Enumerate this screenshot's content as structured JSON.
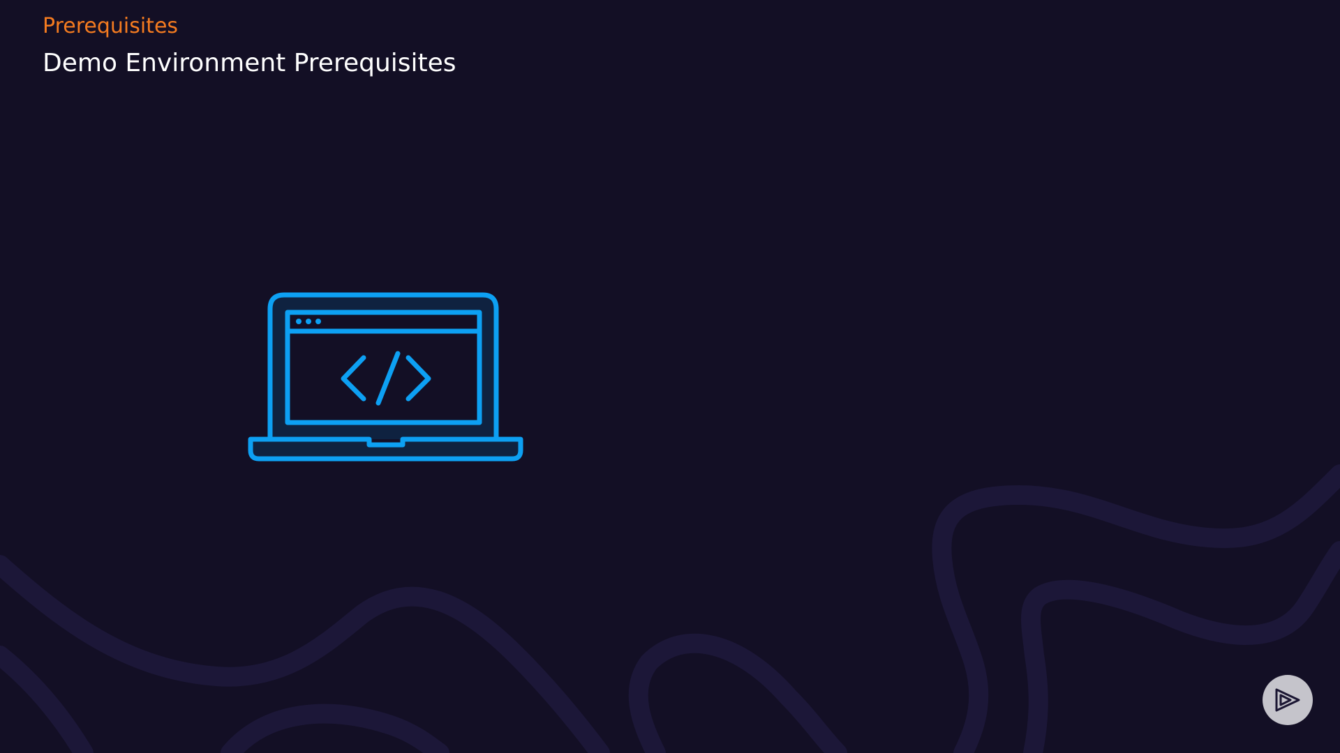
{
  "slide": {
    "eyebrow": "Prerequisites",
    "title": "Demo Environment Prerequisites"
  },
  "illustration": {
    "icon": "laptop-code-icon",
    "color": "#0da0f3"
  },
  "controls": {
    "play_icon": "play-logo-icon"
  },
  "colors": {
    "background": "#130f25",
    "accent": "#f47b20",
    "title": "#ffffff",
    "curve": "#1c1738",
    "play_button_bg": "#c5c4cb"
  }
}
